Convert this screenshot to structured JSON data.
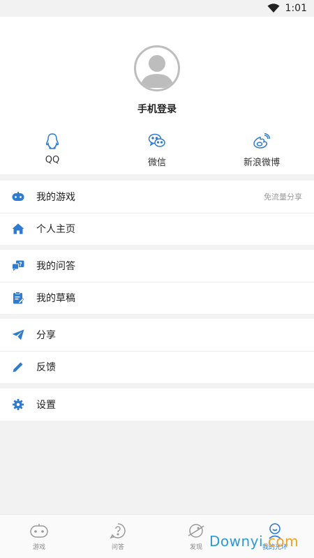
{
  "status_bar": {
    "time": "1:01",
    "wifi_icon": "wifi-icon"
  },
  "profile": {
    "avatar_icon": "default-avatar-icon",
    "login_label": "手机登录",
    "social": [
      {
        "label": "QQ",
        "icon": "qq-icon"
      },
      {
        "label": "微信",
        "icon": "wechat-icon"
      },
      {
        "label": "新浪微博",
        "icon": "weibo-icon"
      }
    ]
  },
  "menu": {
    "group1": [
      {
        "label": "我的游戏",
        "icon": "gamepad-icon",
        "right": "免流量分享"
      },
      {
        "label": "个人主页",
        "icon": "home-icon"
      }
    ],
    "group2": [
      {
        "label": "我的问答",
        "icon": "qa-icon"
      },
      {
        "label": "我的草稿",
        "icon": "draft-icon"
      }
    ],
    "group3": [
      {
        "label": "分享",
        "icon": "send-icon"
      },
      {
        "label": "反馈",
        "icon": "pencil-icon"
      }
    ],
    "group4": [
      {
        "label": "设置",
        "icon": "gear-icon"
      }
    ]
  },
  "tabbar": [
    {
      "label": "游戏",
      "icon": "game-tab-icon",
      "active": false
    },
    {
      "label": "问答",
      "icon": "question-tab-icon",
      "active": false
    },
    {
      "label": "发现",
      "icon": "discover-tab-icon",
      "active": false
    },
    {
      "label": "我的光环",
      "icon": "profile-tab-icon",
      "active": true
    }
  ],
  "watermark": {
    "part1": "Downyi",
    "part2": ".com"
  },
  "colors": {
    "accent": "#2f7bd0",
    "background": "#f2f2f2",
    "divider": "#ececec"
  }
}
